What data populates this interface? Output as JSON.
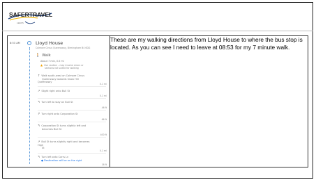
{
  "logo": {
    "alt": "SaferTravel",
    "word1": "SAFER",
    "word2": "TRAVEL",
    "tagline": "LEEDS"
  },
  "caption": "These are my walking directions from Lloyd House to where the bus stop is located.  As you can see I need to leave at 08:53 for my 7 minute walk.",
  "route": {
    "depart_time": "8:53 AM",
    "origin": "Lloyd House",
    "origin_address": "Colmore Circus Queensway, Birmingham B4 6DG",
    "mode": "Walk",
    "duration": "About 7 min, 0.5 mi",
    "caution": [
      "Use caution – may involve errors or",
      "sections not suited for walking"
    ],
    "steps": [
      {
        "icon": "walk",
        "text": [
          "Walk south-west on Colmore Circus",
          "Queensway towards Snow Hill Queensway"
        ],
        "dist": "0.1 mi"
      },
      {
        "icon": "slight-right",
        "text": [
          "Slight right onto Bull St"
        ],
        "dist": "0.1 mi"
      },
      {
        "icon": "turn-left",
        "text": [
          "Turn left to stay on Bull St"
        ],
        "dist": "46 ft"
      },
      {
        "icon": "turn-right",
        "text": [
          "Turn right onto Corporation St"
        ],
        "dist": "66 ft"
      },
      {
        "icon": "turn-left",
        "text": [
          "Corporation St turns slightly left and",
          "becomes Bull St"
        ],
        "dist": "400 ft"
      },
      {
        "icon": "slight-right",
        "text": [
          "Bull St turns slightly right and becomes High",
          "St"
        ],
        "dist": "0.1 mi"
      },
      {
        "icon": "turn-left",
        "text": [
          "Turn left onto Carrs Ln"
        ],
        "dist": "16 ft"
      }
    ],
    "destination_note": "Destination will be on the right",
    "last_dist": "16 ft"
  }
}
